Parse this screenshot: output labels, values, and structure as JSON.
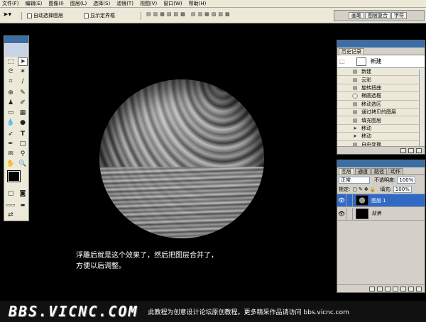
{
  "menu": [
    "文件(F)",
    "编辑(E)",
    "图像(I)",
    "图层(L)",
    "选择(S)",
    "滤镜(T)",
    "视图(V)",
    "窗口(W)",
    "帮助(H)"
  ],
  "options": {
    "auto_select": "自动选择图层",
    "show_bounds": "显示定界框"
  },
  "well_tabs": [
    "画笔",
    "图层复合",
    "字符"
  ],
  "history": {
    "tabs": [
      "历史记录"
    ],
    "snapshot": "新建",
    "items": [
      "新建",
      "云彩",
      "旋转扭曲",
      "椭圆选框",
      "移动选区",
      "通过拷贝的图层",
      "填充图层",
      "移动",
      "移动",
      "自由变换",
      "移动"
    ]
  },
  "layers": {
    "tabs": [
      "图层",
      "通道",
      "路径",
      "动作"
    ],
    "mode": "正常",
    "opacity_label": "不透明度:",
    "opacity": "100%",
    "lock_label": "锁定:",
    "fill_label": "填充:",
    "fill": "100%",
    "items": [
      {
        "name": "图层 1",
        "selected": true
      },
      {
        "name": "背景",
        "selected": false
      }
    ]
  },
  "caption": [
    "浮雕后就是这个效果了，然后把图层合并了，",
    "方便以后调整。"
  ],
  "watermark": {
    "logo": "BBS.VICNC.COM",
    "text": "此教程为创意设计论坛原创教程。更多精采作品请访问 bbs.vicnc.com"
  },
  "colors": {
    "accent": "#3a6ea5",
    "selected_layer": "#316ac5",
    "chrome": "#ece9d8"
  }
}
